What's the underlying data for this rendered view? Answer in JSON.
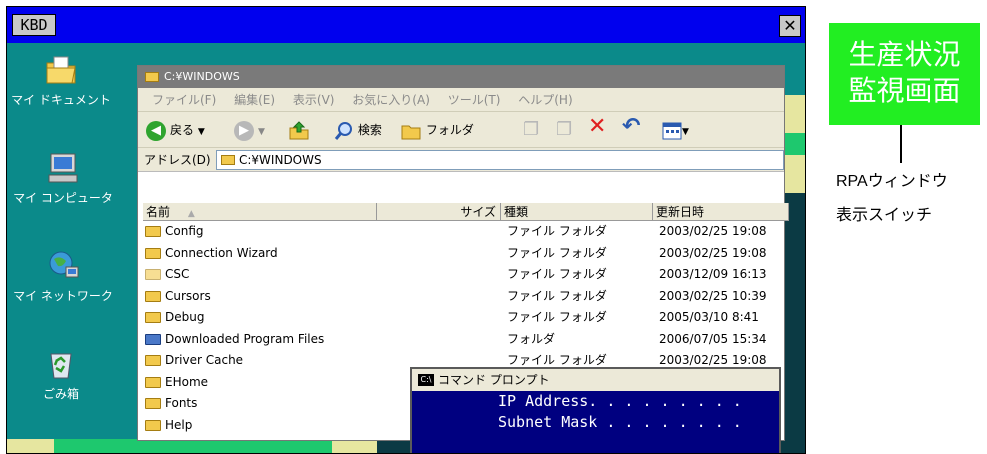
{
  "rpa_window": {
    "title": "KBD",
    "close_glyph": "✕"
  },
  "desktop_icons": [
    {
      "label": "マイ ドキュメント"
    },
    {
      "label": "マイ コンピュータ"
    },
    {
      "label": "マイ ネットワーク"
    },
    {
      "label": "ごみ箱"
    }
  ],
  "explorer": {
    "title": "C:¥WINDOWS",
    "menu": [
      "ファイル(F)",
      "編集(E)",
      "表示(V)",
      "お気に入り(A)",
      "ツール(T)",
      "ヘルプ(H)"
    ],
    "toolbar": {
      "back": "戻る",
      "search": "検索",
      "folders": "フォルダ"
    },
    "address_label": "アドレス(D)",
    "address_value": "C:¥WINDOWS",
    "columns": [
      "名前",
      "サイズ",
      "種類",
      "更新日時"
    ],
    "files": [
      {
        "name": "Config",
        "type": "ファイル フォルダ",
        "date": "2003/02/25 19:08"
      },
      {
        "name": "Connection Wizard",
        "type": "ファイル フォルダ",
        "date": "2003/02/25 19:08"
      },
      {
        "name": "CSC",
        "type": "ファイル フォルダ",
        "date": "2003/12/09 16:13"
      },
      {
        "name": "Cursors",
        "type": "ファイル フォルダ",
        "date": "2003/02/25 10:39"
      },
      {
        "name": "Debug",
        "type": "ファイル フォルダ",
        "date": "2005/03/10 8:41"
      },
      {
        "name": "Downloaded Program Files",
        "type": "フォルダ",
        "date": "2006/07/05 15:34"
      },
      {
        "name": "Driver Cache",
        "type": "ファイル フォルダ",
        "date": "2003/02/25 19:08"
      },
      {
        "name": "EHome",
        "type": "",
        "date": ""
      },
      {
        "name": "Fonts",
        "type": "",
        "date": ""
      },
      {
        "name": "Help",
        "type": "",
        "date": ""
      }
    ]
  },
  "cmd": {
    "title": "コマンド プロンプト",
    "icon_text": "C:\\",
    "lines": [
      "IP Address. . . . . . . . .",
      "Subnet Mask . . . . . . . ."
    ]
  },
  "switch_button": {
    "line1": "生産状況",
    "line2": "監視画面"
  },
  "caption": {
    "line1": "RPAウィンドウ",
    "line2": "表示スイッチ"
  },
  "colors": {
    "title_blue": "#0000ee",
    "desktop_teal": "#0b8a8a",
    "switch_green": "#22ee22",
    "cmd_navy": "#000080"
  }
}
